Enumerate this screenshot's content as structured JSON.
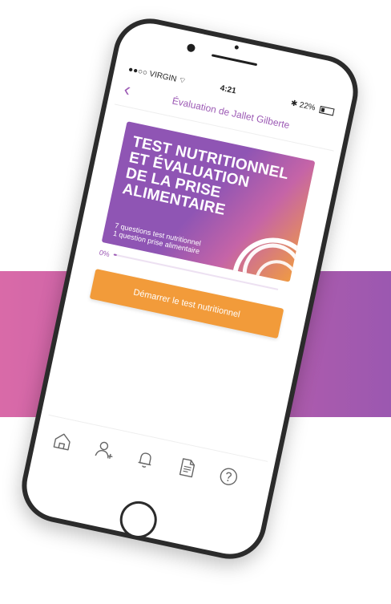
{
  "status_bar": {
    "carrier": "●●○○ VIRGIN",
    "time": "4:21",
    "battery": "22%"
  },
  "nav": {
    "back_icon": "chevron-left-icon",
    "title": "Évaluation de Jallet Gilberte"
  },
  "card": {
    "title_lines": [
      "TEST NUTRITIONNEL",
      "ET ÉVALUATION",
      "DE LA PRISE",
      "ALIMENTAIRE"
    ],
    "subtitle_lines": [
      "7 questions test nutritionnel",
      "1 question prise alimentaire"
    ],
    "decoration_icon": "concentric-arcs-icon",
    "gradient_colors": [
      "#8f55b4",
      "#c564a7",
      "#ef9a44"
    ]
  },
  "progress": {
    "label": "0%",
    "value_percent": 0
  },
  "start_button": {
    "label": "Démarrer le test nutritionnel",
    "color": "#f29b3a"
  },
  "tab_bar": {
    "items": [
      {
        "icon": "home-icon"
      },
      {
        "icon": "add-user-icon"
      },
      {
        "icon": "bell-icon"
      },
      {
        "icon": "document-icon"
      },
      {
        "icon": "help-icon"
      }
    ]
  },
  "colors": {
    "accent": "#9d5bb5",
    "band": "#c35fa9",
    "button": "#f29b3a"
  }
}
